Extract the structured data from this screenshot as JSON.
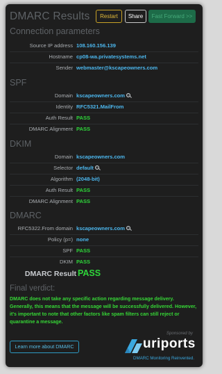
{
  "header": {
    "title": "DMARC Results",
    "restart_label": "Restart",
    "share_label": "Share",
    "fast_forward_label": "Fast Forward >>"
  },
  "connection": {
    "heading": "Connection parameters",
    "rows": [
      {
        "label": "Source IP address",
        "value": "108.160.156.139"
      },
      {
        "label": "Hostname",
        "value": "cp08-wa.privatesystems.net"
      },
      {
        "label": "Sender",
        "value": "webmaster@kscapeowners.com"
      }
    ]
  },
  "spf": {
    "heading": "SPF",
    "rows": [
      {
        "label": "Domain",
        "value": "kscapeowners.com"
      },
      {
        "label": "Identity",
        "value": "RFC5321.MailFrom"
      },
      {
        "label": "Auth Result",
        "value": "PASS"
      },
      {
        "label": "DMARC Alignment",
        "value": "PASS"
      }
    ]
  },
  "dkim": {
    "heading": "DKIM",
    "rows": [
      {
        "label": "Domain",
        "value": "kscapeowners.com"
      },
      {
        "label": "Selector",
        "value": "default"
      },
      {
        "label": "Algorithm",
        "value": "(2048-bit)"
      },
      {
        "label": "Auth Result",
        "value": "PASS"
      },
      {
        "label": "DMARC Alignment",
        "value": "PASS"
      }
    ]
  },
  "dmarc": {
    "heading": "DMARC",
    "rows": [
      {
        "label": "RFC5322.From domain",
        "value": "kscapeowners.com"
      },
      {
        "label": "Policy (p=)",
        "value": "none"
      },
      {
        "label": "SPF",
        "value": "PASS"
      },
      {
        "label": "DKIM",
        "value": "PASS"
      }
    ],
    "result_label": "DMARC Result",
    "result_value": "PASS"
  },
  "verdict": {
    "heading": "Final verdict:",
    "text": "DMARC does not take any specific action regarding message delivery. Generally, this means that the message will be successfully delivered. However, it's important to note that other factors like spam filters can still reject or quarantine a message."
  },
  "footer": {
    "learn_more_label": "Learn more about DMARC",
    "sponsored_by": "Sponsored by",
    "logo_text": "uriports",
    "logo_tagline": "DMARC Monitoring Reinvented."
  },
  "colors": {
    "pass": "#2ed63a",
    "value_blue": "#4cb7ee",
    "restart_accent": "#c9a227",
    "fast_forward_bg": "#1d6b48"
  }
}
